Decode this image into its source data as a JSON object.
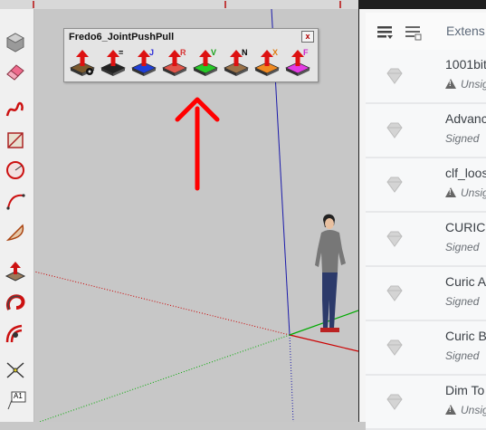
{
  "window": {
    "toolbar_title": "Fredo6_JointPushPull",
    "close_label": "x"
  },
  "jpp_buttons": [
    {
      "id": "vector-pushpull",
      "letter": "",
      "letter_color": "#000000",
      "base": "#7b5a2e"
    },
    {
      "id": "equal-pushpull",
      "letter": "=",
      "letter_color": "#000000",
      "base": "#222222"
    },
    {
      "id": "joint-pushpull",
      "letter": "J",
      "letter_color": "#2b2bd8",
      "base": "#1f3fd8"
    },
    {
      "id": "round-pushpull",
      "letter": "R",
      "letter_color": "#d62f2f",
      "base": "#e0554a"
    },
    {
      "id": "vector-v-pushpull",
      "letter": "V",
      "letter_color": "#18a018",
      "base": "#27c927"
    },
    {
      "id": "normal-pushpull",
      "letter": "N",
      "letter_color": "#000000",
      "base": "#9a7248"
    },
    {
      "id": "extrude-x-pushpull",
      "letter": "X",
      "letter_color": "#e07a10",
      "base": "#f08a22"
    },
    {
      "id": "follow-f-pushpull",
      "letter": "F",
      "letter_color": "#cc22cc",
      "base": "#e33ce3"
    }
  ],
  "right_panel": {
    "tab_label": "Extens",
    "extensions": [
      {
        "name": "1001bit",
        "status": "Unsig",
        "warning": true
      },
      {
        "name": "Advanc",
        "status": "Signed",
        "warning": false
      },
      {
        "name": "clf_loos",
        "status": "Unsig",
        "warning": true
      },
      {
        "name": "CURIC A",
        "status": "Signed",
        "warning": false
      },
      {
        "name": "Curic A",
        "status": "Signed",
        "warning": false
      },
      {
        "name": "Curic B",
        "status": "Signed",
        "warning": false
      },
      {
        "name": "Dim To",
        "status": "Unsig",
        "warning": true
      }
    ]
  },
  "left_tools": [
    "orbit-icon",
    "eraser-icon",
    "freehand-icon",
    "rectangle-rotate-icon",
    "circle-icon",
    "arc-icon",
    "pie-icon",
    "pushpull-icon",
    "followme-icon",
    "offset-icon",
    "tape-measure-icon",
    "text-label-icon"
  ],
  "left_tools_text": {
    "text_label": "A1"
  },
  "colors": {
    "annotation_arrow": "#ff0000",
    "axis_red": "#cc0000",
    "axis_green": "#00aa00",
    "axis_blue": "#1a1aaa"
  }
}
